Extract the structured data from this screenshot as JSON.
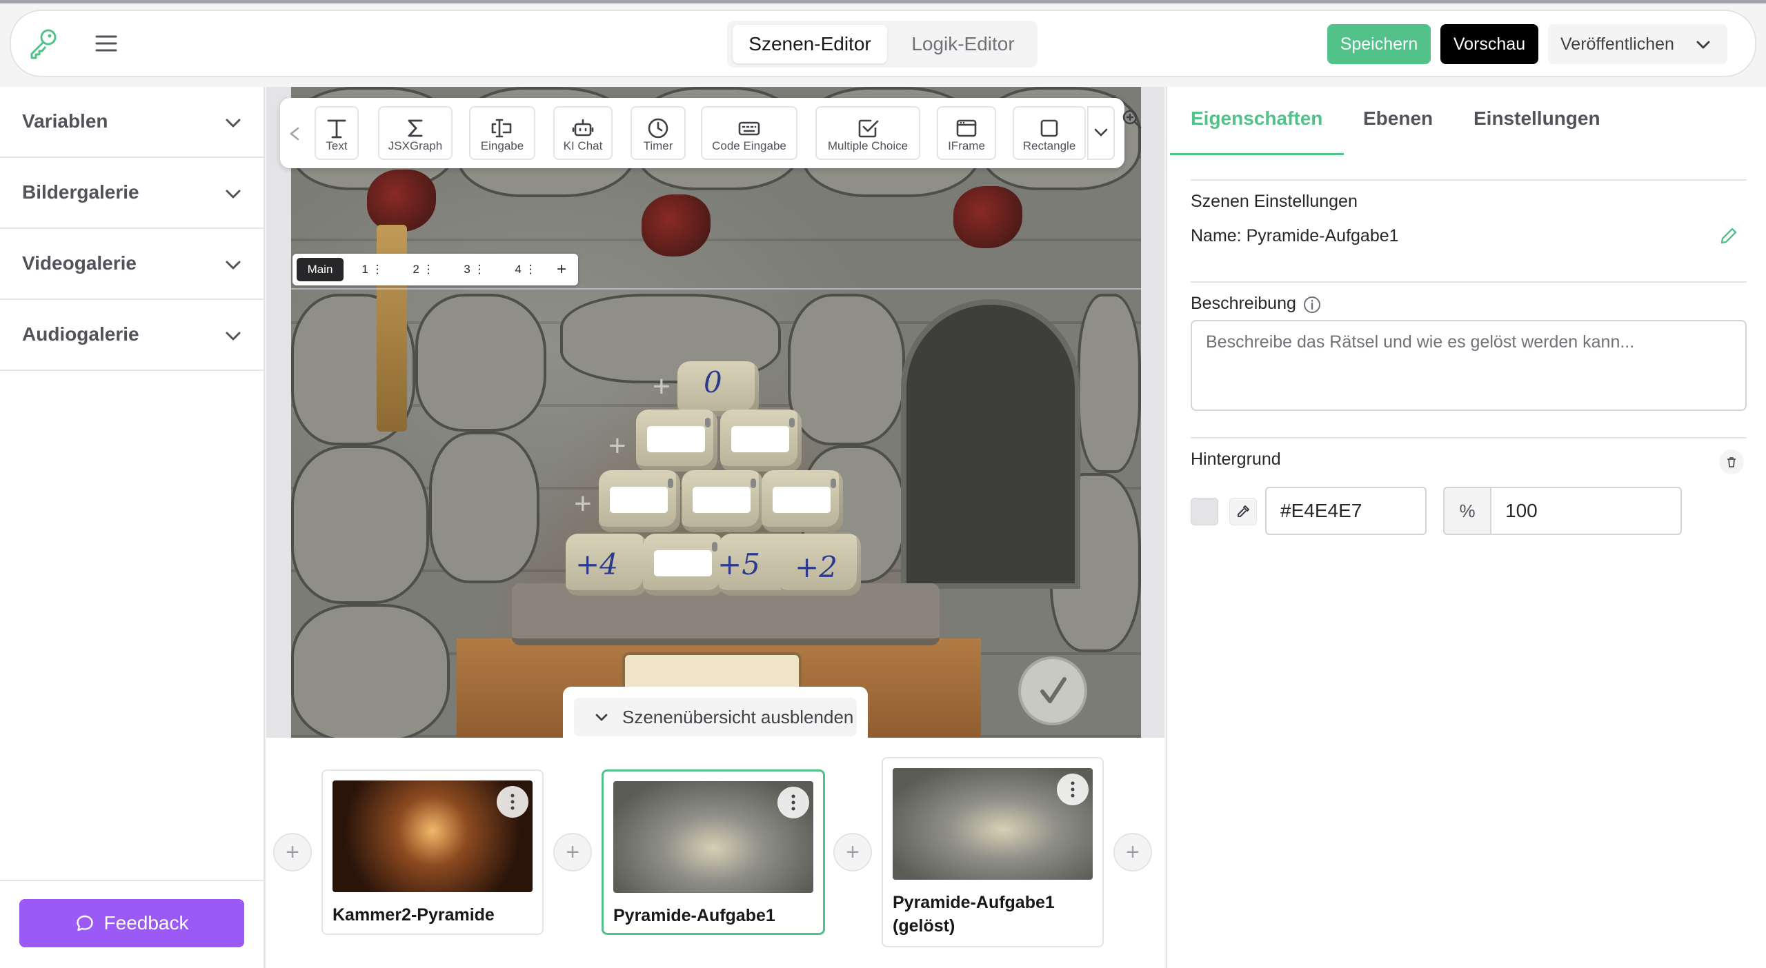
{
  "header": {
    "tabs": [
      {
        "label": "Szenen-Editor",
        "active": true
      },
      {
        "label": "Logik-Editor",
        "active": false
      }
    ],
    "save_label": "Speichern",
    "preview_label": "Vorschau",
    "publish_label": "Veröffentlichen",
    "accent_color": "#52C18A"
  },
  "sidebar": {
    "sections": [
      "Variablen",
      "Bildergalerie",
      "Videogalerie",
      "Audiogalerie"
    ],
    "feedback_label": "Feedback"
  },
  "toolbar": {
    "tools": [
      "Text",
      "JSXGraph",
      "Eingabe",
      "KI Chat",
      "Timer",
      "Code Eingabe",
      "Multiple Choice",
      "IFrame",
      "Rectangle"
    ]
  },
  "layers": {
    "tabs": [
      "Main",
      "1",
      "2",
      "3",
      "4"
    ]
  },
  "scene": {
    "handwritten": {
      "top": "0",
      "left": "+4",
      "mid": "+5",
      "right": "+2"
    }
  },
  "overview": {
    "hide_label": "Szenenübersicht ausblenden",
    "scenes": [
      {
        "title": "Kammer2-Pyramide",
        "selected": false
      },
      {
        "title": "Pyramide-Aufgabe1",
        "selected": true
      },
      {
        "title": "Pyramide-Aufgabe1 (gelöst)",
        "selected": false
      }
    ]
  },
  "panel": {
    "tabs": [
      {
        "label": "Eigenschaften",
        "active": true
      },
      {
        "label": "Ebenen",
        "active": false
      },
      {
        "label": "Einstellungen",
        "active": false
      }
    ],
    "scene_settings_label": "Szenen Einstellungen",
    "scene_name": "Name: Pyramide-Aufgabe1",
    "description_label": "Beschreibung",
    "description_placeholder": "Beschreibe das Rätsel und wie es gelöst werden kann...",
    "background_label": "Hintergrund",
    "background_color": "#E4E4E7",
    "opacity_unit": "%",
    "opacity": "100"
  }
}
